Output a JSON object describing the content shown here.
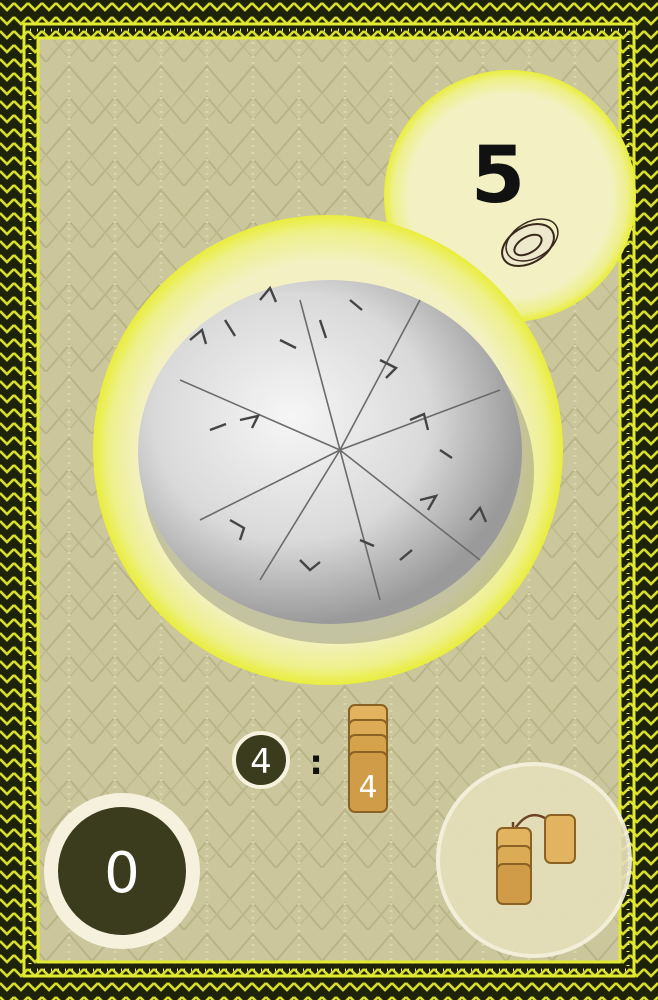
{
  "card": {
    "value": "5",
    "trade_count": "4",
    "stack_count": "4",
    "separator": ":",
    "points": "0"
  },
  "colors": {
    "border_dark": "#1d2209",
    "border_yellow": "#e3ea32",
    "parchment": "#c9c497",
    "glow": "#f2f36a",
    "token_gold": "#d8a44f",
    "badge_dark": "#3a3c1d"
  },
  "icons": {
    "coin": "ring-coin-icon",
    "tablet": "clay-tablet-icon",
    "tile_stack": "tile-stack-icon",
    "move": "move-tile-icon"
  }
}
